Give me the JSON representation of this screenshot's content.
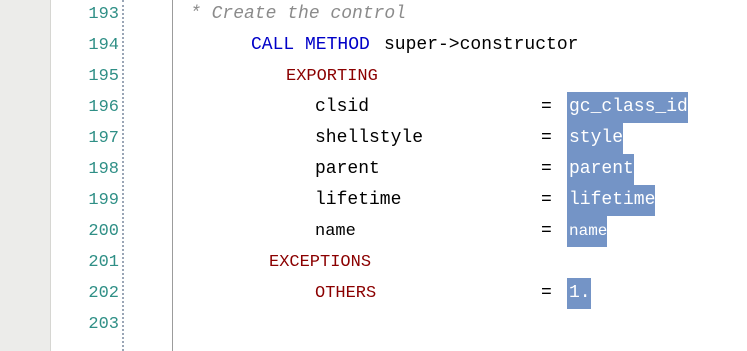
{
  "editor": {
    "lines": {
      "l193": {
        "num": "193",
        "comment": "* Create the control"
      },
      "l194": {
        "num": "194",
        "kw": "CALL METHOD",
        "rest": "super->constructor"
      },
      "l195": {
        "num": "195",
        "kw": "EXPORTING"
      },
      "l196": {
        "num": "196",
        "name": "clsid",
        "op": "=",
        "value": "gc_class_id"
      },
      "l197": {
        "num": "197",
        "name": "shellstyle",
        "op": "=",
        "value": "style"
      },
      "l198": {
        "num": "198",
        "name": "parent",
        "op": "=",
        "value": "parent"
      },
      "l199": {
        "num": "199",
        "name": "lifetime",
        "op": "=",
        "value": "lifetime"
      },
      "l200": {
        "num": "200",
        "name": "name",
        "op": "=",
        "value": "name"
      },
      "l201": {
        "num": "201",
        "kw": "EXCEPTIONS"
      },
      "l202": {
        "num": "202",
        "name": "OTHERS",
        "op": "=",
        "value": "1."
      },
      "l203": {
        "num": "203"
      }
    }
  },
  "colors": {
    "line_number": "#2f8f86",
    "keyword_blue": "#0000c8",
    "keyword_dark_red": "#8b0000",
    "comment_gray": "#8b8b8b",
    "selection": "#7494c6"
  }
}
